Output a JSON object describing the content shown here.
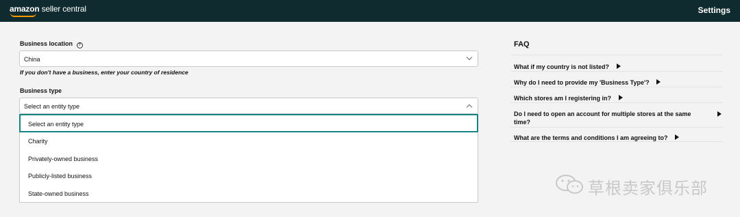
{
  "header": {
    "logo_brand": "amazon",
    "logo_product": "seller central",
    "settings_label": "Settings"
  },
  "form": {
    "business_location": {
      "label": "Business location",
      "value": "China",
      "hint": "If you don't have a business, enter your country of residence"
    },
    "business_type": {
      "label": "Business type",
      "value": "Select an entity type",
      "options": [
        "Select an entity type",
        "Charity",
        "Privately-owned business",
        "Publicly-listed business",
        "State-owned business"
      ],
      "selected_index": 0
    }
  },
  "faq": {
    "title": "FAQ",
    "items": [
      "What if my country is not listed?",
      "Why do I need to provide my 'Business Type'?",
      "Which stores am I registering in?",
      "Do I need to open an account for multiple stores at the same time?",
      "What are the terms and conditions I am agreeing to?"
    ]
  },
  "watermark": {
    "text": "草根卖家俱乐部"
  },
  "colors": {
    "header_bg": "#0f2b2f",
    "accent_teal": "#138384",
    "logo_orange": "#ff9900"
  }
}
